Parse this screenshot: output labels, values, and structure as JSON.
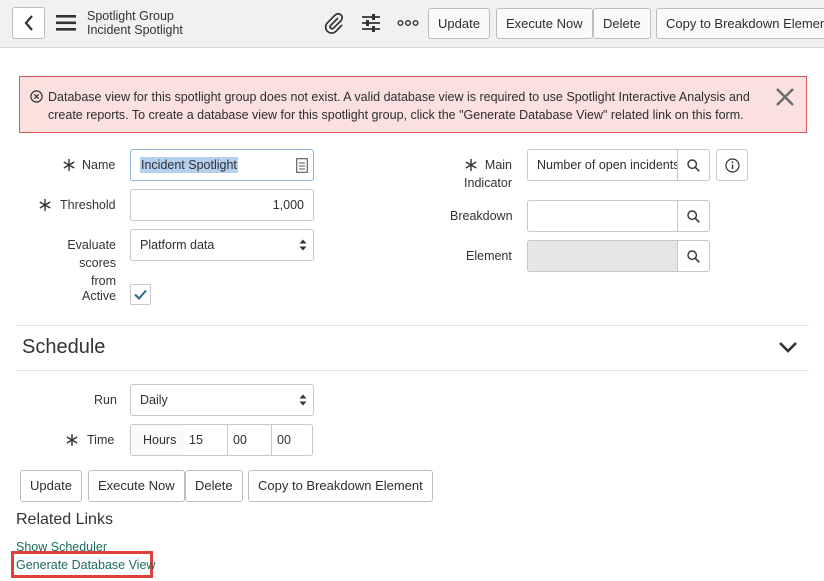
{
  "header": {
    "title": "Spotlight Group",
    "subtitle": "Incident Spotlight",
    "buttons": {
      "update": "Update",
      "execute_now": "Execute Now",
      "delete": "Delete",
      "copy": "Copy to Breakdown Element"
    }
  },
  "alert": {
    "text": "Database view for this spotlight group does not exist. A valid database view is required to use Spotlight Interactive Analysis and create reports. To create a database view for this spotlight group, click the \"Generate Database View\" related link on this form."
  },
  "form": {
    "name_label": "Name",
    "name_value": "Incident Spotlight",
    "threshold_label": "Threshold",
    "threshold_value": "1,000",
    "evaluate_label_1": "Evaluate scores",
    "evaluate_label_2": "from",
    "evaluate_value": "Platform data",
    "active_label": "Active",
    "active_checked": true,
    "main_label_1": "Main",
    "main_label_2": "Indicator",
    "main_value": "Number of open incidents",
    "breakdown_label": "Breakdown",
    "breakdown_value": "",
    "element_label": "Element",
    "element_value": ""
  },
  "schedule": {
    "title": "Schedule",
    "run_label": "Run",
    "run_value": "Daily",
    "time_label": "Time",
    "hours_label": "Hours",
    "hours_value": "15",
    "minutes_value": "00",
    "seconds_value": "00"
  },
  "footer_buttons": {
    "update": "Update",
    "execute_now": "Execute Now",
    "delete": "Delete",
    "copy": "Copy to Breakdown Element"
  },
  "related_links": {
    "title": "Related Links",
    "show_scheduler": "Show Scheduler",
    "generate_view": "Generate Database View"
  },
  "colors": {
    "alert_bg": "#fbe0e0",
    "alert_border": "#d65a5a",
    "link": "#1c6b5e",
    "highlight_box": "#e0403a"
  }
}
